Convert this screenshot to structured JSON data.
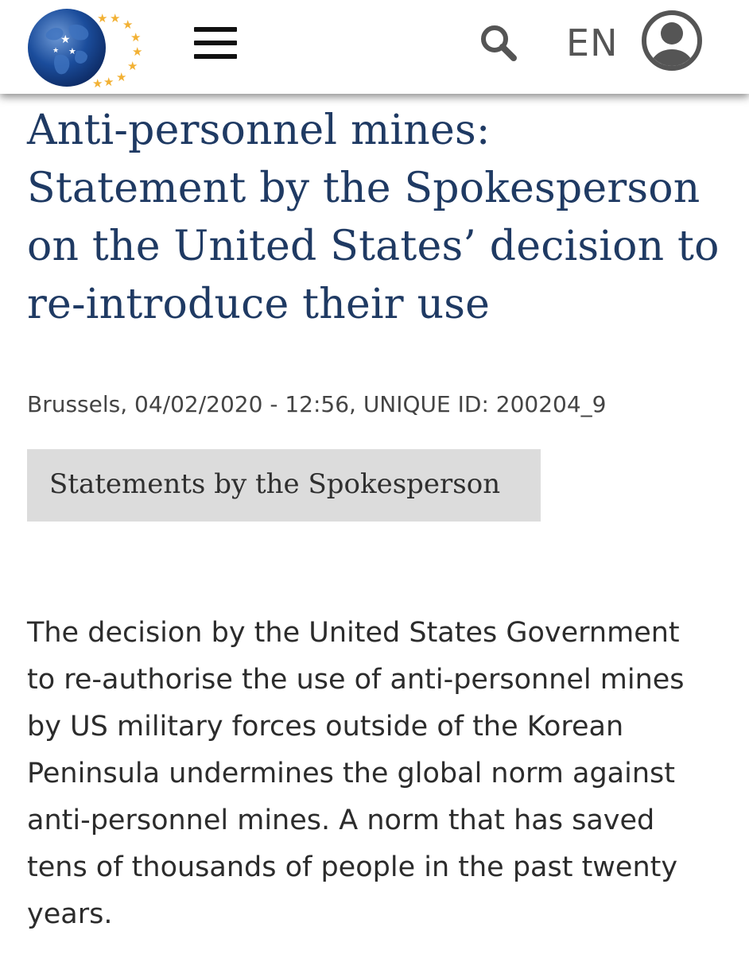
{
  "header": {
    "logo_icon": "eu-globe-stars-logo",
    "menu_icon": "hamburger-menu-icon",
    "search_icon": "search-icon",
    "language_label": "EN",
    "user_icon": "user-account-icon"
  },
  "article": {
    "title_lines": [
      "Anti-personnel mines:",
      "Statement by the Spokesperson",
      "on the United States’ decision to",
      "re-introduce their use"
    ],
    "meta": "Brussels, 04/02/2020 - 12:56, UNIQUE ID: 200204_9",
    "category_tag": "Statements by the Spokesperson",
    "body_lines": [
      "The decision by the United States Government",
      "to re-authorise the use of anti-personnel mines",
      "by US military forces outside of the Korean",
      "Peninsula undermines the global norm against",
      "anti-personnel mines. A norm that has saved",
      "tens of thousands of people in the past twenty",
      "years."
    ]
  },
  "colors": {
    "title": "#1f3a63",
    "globe": "#1b4d9c",
    "stars": "#f2b134",
    "tag_background": "#dcdcdc",
    "icon_gray": "#555555"
  }
}
